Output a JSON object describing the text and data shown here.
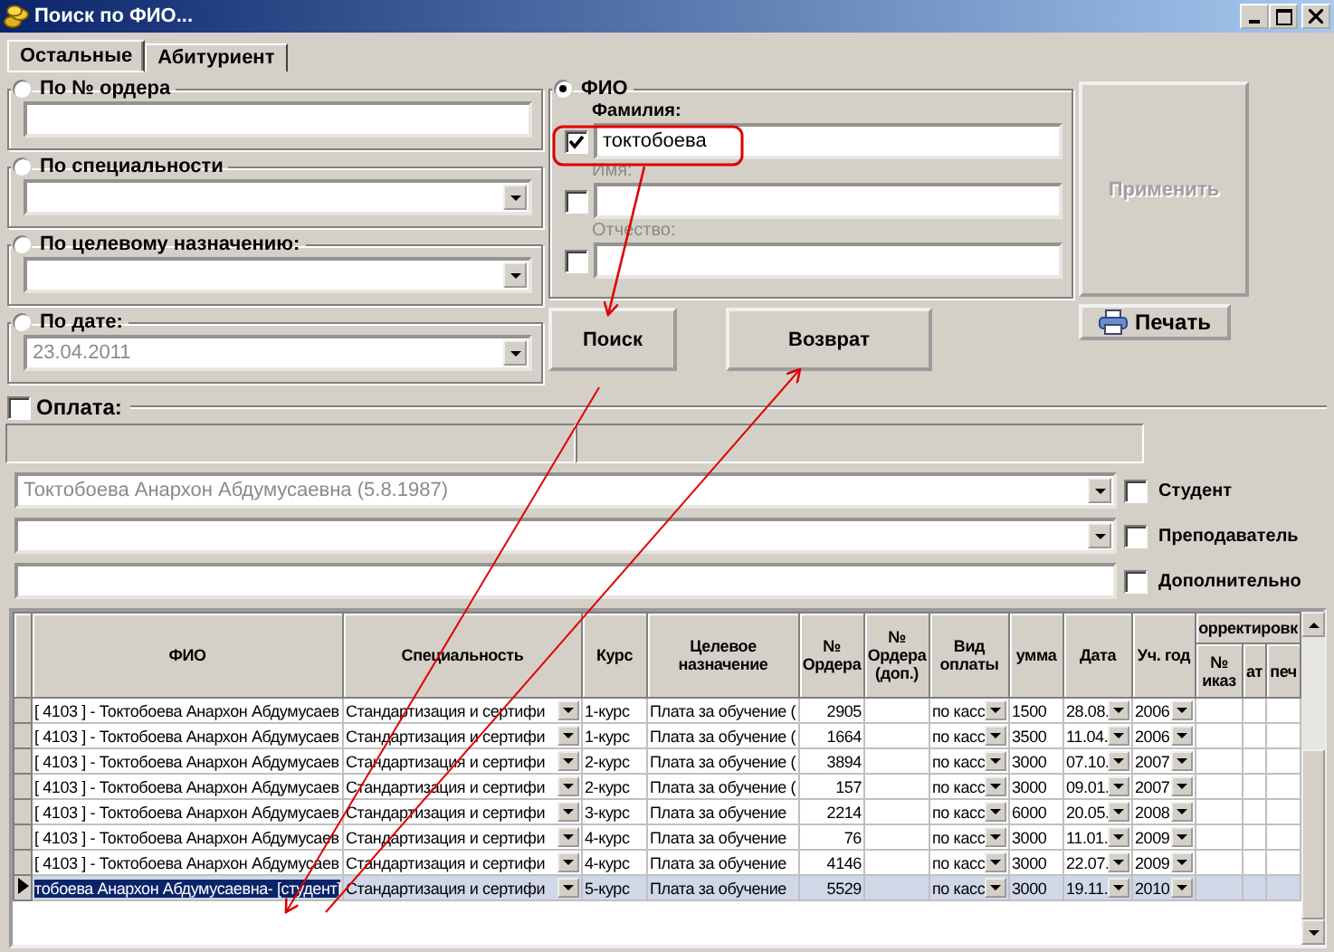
{
  "window": {
    "title": "Поиск по ФИО..."
  },
  "tabs": [
    {
      "label": "Остальные",
      "selected": true
    },
    {
      "label": "Абитуриент",
      "selected": false
    }
  ],
  "filters": [
    {
      "kind": "text",
      "label": "По № ордера",
      "selected": false
    },
    {
      "kind": "combo",
      "label": "По специальности",
      "selected": false
    },
    {
      "kind": "combo",
      "label": "По целевому назначению:",
      "selected": false
    },
    {
      "kind": "combo",
      "label": "По дате:",
      "selected": false,
      "value": "23.04.2011",
      "disabled": true
    }
  ],
  "fio": {
    "label": "ФИО",
    "selected": true,
    "fields": [
      {
        "label": "Фамилия:",
        "checked": true,
        "value": "токтобоева"
      },
      {
        "label": "Имя:",
        "checked": false
      },
      {
        "label": "Отчество:",
        "checked": false
      }
    ]
  },
  "buttons": {
    "search": "Поиск",
    "back": "Возврат",
    "apply": {
      "label": "Применить",
      "disabled": true
    },
    "print": "Печать"
  },
  "payment": {
    "label": "Оплата:",
    "checked": false
  },
  "persons": [
    {
      "kind": "combo",
      "value": "Токтобоева Анархон Абдумусаевна (5.8.1987)",
      "disabled": true,
      "label": "Студент",
      "checked": false
    },
    {
      "kind": "combo",
      "label": "Преподаватель",
      "checked": false
    },
    {
      "kind": "text",
      "label": "Дополнительно",
      "checked": false
    }
  ],
  "table": {
    "columns": [
      {
        "label": "ФИО",
        "kind": "text"
      },
      {
        "label": "Специальность",
        "kind": "combo"
      },
      {
        "label": "Курс",
        "kind": "text"
      },
      {
        "label": "Целевое назначение",
        "kind": "text"
      },
      {
        "label": "№ Ордера",
        "kind": "number"
      },
      {
        "label": "№ Ордера (доп.)",
        "kind": "number"
      },
      {
        "label": "Вид оплаты",
        "kind": "combo"
      },
      {
        "label": "умма",
        "kind": "text"
      },
      {
        "label": "Дата",
        "kind": "combo"
      },
      {
        "label": "Уч. год",
        "kind": "combo"
      }
    ],
    "group_column": {
      "label": "орректировк",
      "children": [
        {
          "label": "№ иказ"
        },
        {
          "label": "ат"
        },
        {
          "label": "печ"
        }
      ]
    },
    "rows": [
      {
        "cells": [
          "[ 4103 ] - Токтобоева Анархон Абдумусаев",
          "Стандартизация и сертифи",
          "1-курс",
          "Плата за обучение (",
          "2905",
          null,
          "по касс",
          "1500",
          "28.08.",
          "2006"
        ],
        "selected": false
      },
      {
        "cells": [
          "[ 4103 ] - Токтобоева Анархон Абдумусаев",
          "Стандартизация и сертифи",
          "1-курс",
          "Плата за обучение (",
          "1664",
          null,
          "по касс",
          "3500",
          "11.04.",
          "2006"
        ],
        "selected": false
      },
      {
        "cells": [
          "[ 4103 ] - Токтобоева Анархон Абдумусаев",
          "Стандартизация и сертифи",
          "2-курс",
          "Плата за обучение (",
          "3894",
          null,
          "по касс",
          "3000",
          "07.10.",
          "2007"
        ],
        "selected": false
      },
      {
        "cells": [
          "[ 4103 ] - Токтобоева Анархон Абдумусаев",
          "Стандартизация и сертифи",
          "2-курс",
          "Плата за обучение (",
          "157",
          null,
          "по касс",
          "3000",
          "09.01.",
          "2007"
        ],
        "selected": false
      },
      {
        "cells": [
          "[ 4103 ] - Токтобоева Анархон Абдумусаев",
          "Стандартизация и сертифи",
          "3-курс",
          "Плата за обучение",
          "2214",
          null,
          "по касс",
          "6000",
          "20.05.",
          "2008"
        ],
        "selected": false
      },
      {
        "cells": [
          "[ 4103 ] - Токтобоева Анархон Абдумусаев",
          "Стандартизация и сертифи",
          "4-курс",
          "Плата за обучение",
          "76",
          null,
          "по касс",
          "3000",
          "11.01.",
          "2009"
        ],
        "selected": false
      },
      {
        "cells": [
          "[ 4103 ] - Токтобоева Анархон Абдумусаев",
          "Стандартизация и сертифи",
          "4-курс",
          "Плата за обучение",
          "4146",
          null,
          "по касс",
          "3000",
          "22.07.",
          "2009"
        ],
        "selected": false
      },
      {
        "cells": [
          "тобоева Анархон Абдумусаевна- [студент]",
          "Стандартизация и сертифи",
          "5-курс",
          "Плата за обучение",
          "5529",
          null,
          "по касс",
          "3000",
          "19.11.",
          "2010"
        ],
        "selected": true
      }
    ]
  }
}
